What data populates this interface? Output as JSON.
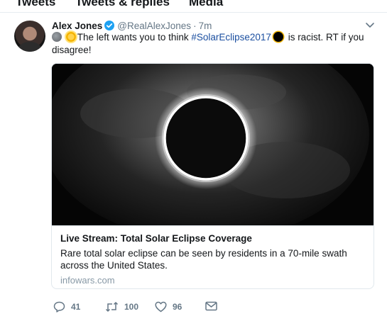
{
  "tabs": [
    "Tweets",
    "Tweets & replies",
    "Media"
  ],
  "tweet": {
    "author_name": "Alex Jones",
    "handle": "@RealAlexJones",
    "separator": "·",
    "time": "7m",
    "text_part1": "The left wants you to think ",
    "hashtag": "#SolarEclipse2017",
    "text_part2": " is racist. RT if you disagree!",
    "card": {
      "title": "Live Stream: Total Solar Eclipse Coverage",
      "description": "Rare total solar eclipse can be seen by residents in a 70-mile swath across the United States.",
      "domain": "infowars.com"
    },
    "stats": {
      "replies": "41",
      "retweets": "100",
      "likes": "96"
    }
  },
  "icons": {
    "verified": "verified-badge-icon",
    "caret": "chevron-down-icon",
    "reply": "reply-icon",
    "retweet": "retweet-icon",
    "like": "heart-icon",
    "message": "envelope-icon"
  },
  "colors": {
    "link": "#1b4fa0",
    "verified": "#1da1f2",
    "muted": "#657786"
  }
}
